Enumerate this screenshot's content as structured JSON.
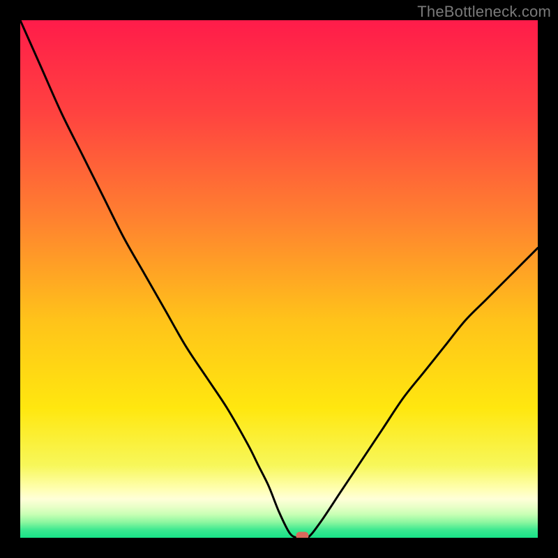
{
  "watermark": "TheBottleneck.com",
  "chart_data": {
    "type": "line",
    "title": "",
    "xlabel": "",
    "ylabel": "",
    "xlim": [
      0,
      100
    ],
    "ylim": [
      0,
      100
    ],
    "grid": false,
    "series": [
      {
        "name": "curve",
        "x": [
          0,
          4,
          8,
          12,
          16,
          20,
          24,
          28,
          32,
          36,
          40,
          44,
          46,
          48,
          50,
          52,
          53.5,
          55.5,
          58,
          62,
          66,
          70,
          74,
          78,
          82,
          86,
          90,
          94,
          98,
          100
        ],
        "y": [
          100,
          91,
          82,
          74,
          66,
          58,
          51,
          44,
          37,
          31,
          25,
          18,
          14,
          10,
          5,
          1,
          0,
          0,
          3,
          9,
          15,
          21,
          27,
          32,
          37,
          42,
          46,
          50,
          54,
          56
        ]
      }
    ],
    "marker": {
      "x": 54.5,
      "y": 0.4,
      "color": "#d9685c"
    },
    "gradient_stops": [
      {
        "offset": 0.0,
        "color": "#ff1c4a"
      },
      {
        "offset": 0.18,
        "color": "#ff4340"
      },
      {
        "offset": 0.38,
        "color": "#ff8030"
      },
      {
        "offset": 0.58,
        "color": "#ffc31a"
      },
      {
        "offset": 0.75,
        "color": "#ffe70f"
      },
      {
        "offset": 0.86,
        "color": "#f7f75a"
      },
      {
        "offset": 0.905,
        "color": "#ffffb0"
      },
      {
        "offset": 0.925,
        "color": "#ffffd8"
      },
      {
        "offset": 0.94,
        "color": "#e9ffc8"
      },
      {
        "offset": 0.955,
        "color": "#c8ffb4"
      },
      {
        "offset": 0.97,
        "color": "#8cf7a0"
      },
      {
        "offset": 0.985,
        "color": "#3be890"
      },
      {
        "offset": 1.0,
        "color": "#17e387"
      }
    ]
  }
}
